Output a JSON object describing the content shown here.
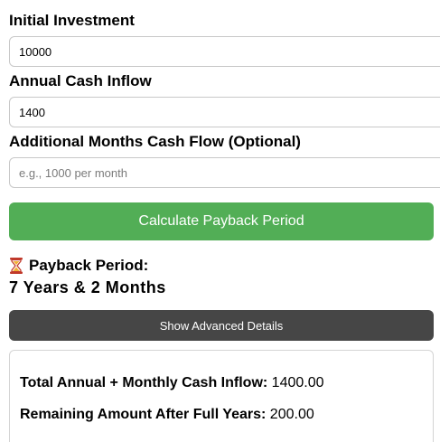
{
  "form": {
    "initial_investment": {
      "label": "Initial Investment",
      "value": "10000",
      "placeholder": ""
    },
    "annual_cash_inflow": {
      "label": "Annual Cash Inflow",
      "value": "1400",
      "placeholder": ""
    },
    "additional_months": {
      "label": "Additional Months Cash Flow (Optional)",
      "value": "",
      "placeholder": "e.g., 1000 per month"
    },
    "calculate_label": "Calculate Payback Period"
  },
  "result": {
    "icon": "hourglass-icon",
    "title": "Payback Period:",
    "value": "7 Years & 2 Months"
  },
  "advanced": {
    "button_label": "Show Advanced Details",
    "total_inflow_label": "Total Annual + Monthly Cash Inflow:",
    "total_inflow_value": "1400.00",
    "remaining_label": "Remaining Amount After Full Years:",
    "remaining_value": "200.00"
  },
  "colors": {
    "calculate_button": "#52ae56",
    "advanced_button": "#464646",
    "hourglass_frame": "#c0392b",
    "hourglass_sand": "#f2b134"
  }
}
